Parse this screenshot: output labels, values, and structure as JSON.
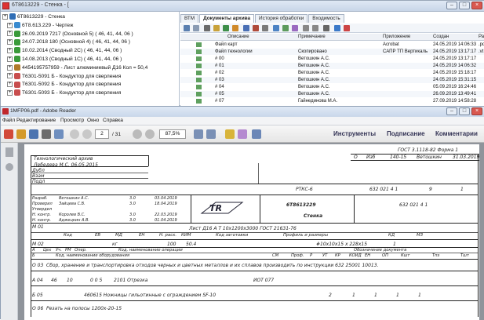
{
  "back_window": {
    "title": "6T8613229 - Стенка - [",
    "tree": [
      {
        "label": "6T8613229 - Стенка",
        "icon": "assembly-icon"
      },
      {
        "label": "6T8.613.229 - Чертеж",
        "icon": "drawing-icon"
      },
      {
        "label": "26.09.2019 7217 (Основной 5) ( 46, 41, 44, 06 )",
        "icon": "version-icon"
      },
      {
        "label": "24.07.2018 180 (Основной 4) ( 46, 41, 44, 06 )",
        "icon": "version-icon"
      },
      {
        "label": "10.02.2014 (Сводный 2C) ( 46, 41, 44, 06 )",
        "icon": "version-icon"
      },
      {
        "label": "14.08.2013 (Сводный 1C) ( 46, 41, 44, 06 )",
        "icon": "version-icon"
      },
      {
        "label": "4454195757959 - Лист алюминиевый Д16  Кол = 50,4",
        "icon": "material-icon"
      },
      {
        "label": "Т6301-5091 Б - Кондуктор для сверления",
        "icon": "tool-icon"
      },
      {
        "label": "Т6301-5092 Б - Кондуктор для сверления",
        "icon": "tool-icon"
      },
      {
        "label": "Т6301-5093 Б - Кондуктор для сверления",
        "icon": "tool-icon"
      }
    ],
    "tabs": [
      "ВТМ",
      "Документы архива",
      "История обработки",
      "Входимость"
    ],
    "grid_headers": [
      "Описание",
      "Примечание",
      "Приложение",
      "Создан",
      "Ра"
    ],
    "grid_rows": [
      {
        "desc": "Файл карт",
        "note": "",
        "app": "Acrobat",
        "created": "24.05.2019 14:06:33",
        "ext": ".pd"
      },
      {
        "desc": "Файл технологии",
        "note": "Скопировано",
        "app": "САПР ТП Вертикаль",
        "created": "24.05.2019 13:17:17",
        "ext": ".vt"
      },
      {
        "desc": "# 00",
        "note": "Ветошкин А.С.",
        "app": "",
        "created": "24.05.2019 13:17:17",
        "ext": ""
      },
      {
        "desc": "# 01",
        "note": "Ветошкин А.С.",
        "app": "",
        "created": "24.05.2019 14:06:32",
        "ext": ""
      },
      {
        "desc": "# 02",
        "note": "Ветошкин А.С.",
        "app": "",
        "created": "24.05.2019 15:18:17",
        "ext": ""
      },
      {
        "desc": "# 03",
        "note": "Ветошкин А.С.",
        "app": "",
        "created": "24.05.2019 15:31:15",
        "ext": ""
      },
      {
        "desc": "# 04",
        "note": "Ветошкин А.С.",
        "app": "",
        "created": "05.09.2019 16:24:46",
        "ext": ""
      },
      {
        "desc": "# 05",
        "note": "Ветошкин А.С.",
        "app": "",
        "created": "26.09.2019 13:49:41",
        "ext": ""
      },
      {
        "desc": "# 07",
        "note": "Гайнединова М.А.",
        "app": "",
        "created": "27.09.2019 14:58:28",
        "ext": ""
      }
    ]
  },
  "reader": {
    "title": "1MFP06.pdf - Adobe Reader",
    "menu": [
      "Файл",
      "Редактирование",
      "Просмотр",
      "Окно",
      "Справка"
    ],
    "page_current": "2",
    "page_total": "/ 31",
    "zoom": "87,5%",
    "right_links": [
      "Инструменты",
      "Подписание",
      "Комментарии"
    ]
  },
  "doc": {
    "gost": "ГОСТ 3.1118-82   Форма 1",
    "archive": "Технологический архив",
    "archive_note": "Лебедева М.С. 06.05.2015",
    "dubl": "Дубл",
    "vzam": "Взам",
    "podl": "Подл",
    "rev_row": [
      "О",
      "Изб",
      "140-15",
      "Ветошкин",
      "31.03.2019"
    ],
    "code_rtk": "РТКС-6",
    "code_main": "632 021 4 1",
    "sheet_total": "9",
    "sheet_no": "1",
    "signs": [
      {
        "role": "Разраб.",
        "name": "Ветошкин А.С.",
        "code": "3.0",
        "date": "03.04.2019"
      },
      {
        "role": "Проверил",
        "name": "Зайцева С.В.",
        "code": "3.0",
        "date": "18.04.2019"
      },
      {
        "role": "Утвердил",
        "name": "",
        "code": "",
        "date": ""
      },
      {
        "role": "Н. контр.",
        "name": "Королев В.С.",
        "code": "3.0",
        "date": "22.03.2019"
      },
      {
        "role": "Н. контр.",
        "name": "Аджецкин А.В.",
        "code": "3.0",
        "date": "01.04.2019"
      }
    ],
    "part_no": "6T8613229",
    "part_name": "Стенка",
    "code_right": "632 021 4 1",
    "m01": "М 01",
    "m01_text": "Лист Д16 А Т 10х1200х3000 ГОСТ 21631-76",
    "m01_heads": [
      "Код",
      "ЕВ",
      "МД",
      "ЕН",
      "Н. расх.",
      "КИМ",
      "Код заготовки",
      "Профиль и размеры",
      "КД",
      "МЗ"
    ],
    "m02": "М 02",
    "m02_vals": [
      "кг",
      "100",
      "50.4",
      "#10х10х15 х 228х15",
      "1"
    ],
    "hdr_a": [
      "А",
      "Цех",
      "Уч.",
      "РМ",
      "Опер.",
      "Код, наименование операции",
      "Обозначение документа"
    ],
    "hdr_b": [
      "Б",
      "Код, наименование оборудования",
      "СМ",
      "Проф.",
      "Р",
      "УТ",
      "КР",
      "КОИД",
      "ЕН",
      "ОП",
      "Кшт",
      "Тпз",
      "Тшт"
    ],
    "o03": "О 03",
    "o03_text": "Сбор, хранение и транспортировка  отходов черных и цветных металлов и их сплавов производить по инструкции 632 25001 10013.",
    "a04": "А 04",
    "a04_vals": [
      "46",
      "10",
      "0 0 5",
      "2101 Отрезка",
      "ИОТ 077"
    ],
    "b05": "Б 05",
    "b05_vals": [
      "460615 Ножницы гильотинные с ограждением SF-10",
      "2",
      "1",
      "1",
      "1",
      "1"
    ],
    "o06": "О 06",
    "o06_text": "Резать на полосы 1200х-20-15"
  },
  "colors": {
    "accent": "#3a6ea5",
    "window_frame": "#9aa7b8",
    "doc_bg": "#8f949b"
  }
}
